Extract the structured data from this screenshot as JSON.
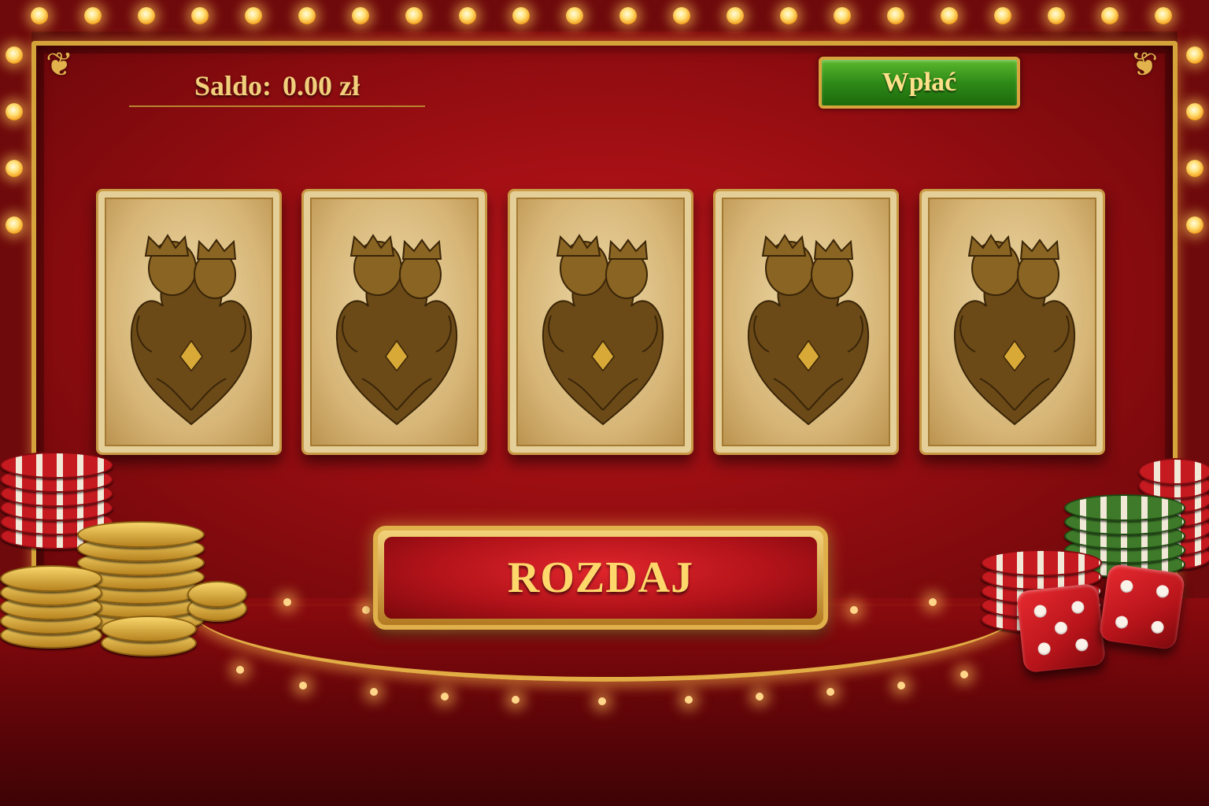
{
  "balance": {
    "label": "Saldo:",
    "amount": "0.00 zł"
  },
  "deposit_button": {
    "label": "Wpłać"
  },
  "cards": [
    {
      "state": "face-down",
      "back_design": "ornate-lion-crest"
    },
    {
      "state": "face-down",
      "back_design": "ornate-lion-crest"
    },
    {
      "state": "face-down",
      "back_design": "ornate-lion-crest"
    },
    {
      "state": "face-down",
      "back_design": "ornate-lion-crest"
    },
    {
      "state": "face-down",
      "back_design": "ornate-lion-crest"
    }
  ],
  "deal_button": {
    "label": "ROZDAJ"
  },
  "decor": {
    "left": [
      "casino-chip-stack-red",
      "casino-chip-stack-gold"
    ],
    "right": [
      "casino-chip-stack-red",
      "casino-chip-stack-green",
      "dice-icon",
      "dice-icon"
    ]
  },
  "colors": {
    "felt": "#a50f14",
    "gold_trim": "#d4a33a",
    "deposit_green": "#2e8a17",
    "deal_red": "#b3131a",
    "text_gold": "#f2cf7a"
  }
}
